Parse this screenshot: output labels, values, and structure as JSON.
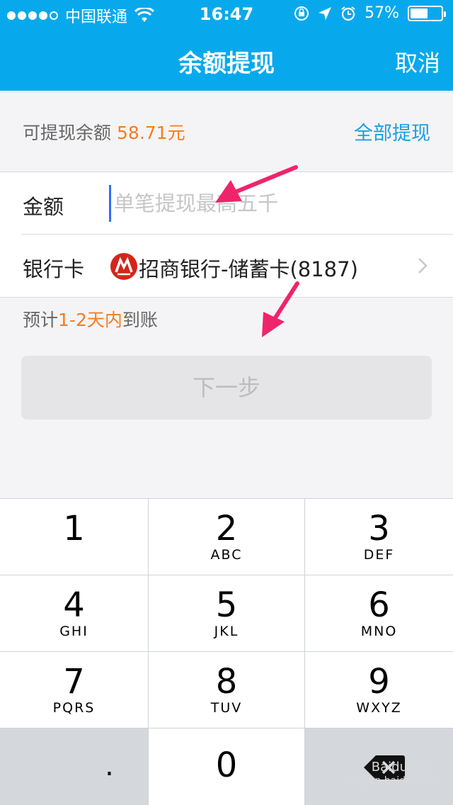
{
  "status_bar": {
    "carrier": "中国联通",
    "time": "16:47",
    "battery": "57%",
    "battery_level": 0.57
  },
  "nav": {
    "title": "余额提现",
    "cancel": "取消"
  },
  "balance": {
    "label": "可提现余额",
    "amount": "58.71元",
    "withdraw_all": "全部提现"
  },
  "form": {
    "amount_label": "金额",
    "amount_placeholder": "单笔提现最高五千",
    "card_label": "银行卡",
    "bank_name": "招商银行-储蓄卡(8187)"
  },
  "eta": {
    "prefix": "预计",
    "highlight": "1-2天内",
    "suffix": "到账"
  },
  "next_button": "下一步",
  "keypad": {
    "keys": [
      {
        "digit": "1",
        "letters": ""
      },
      {
        "digit": "2",
        "letters": "ABC"
      },
      {
        "digit": "3",
        "letters": "DEF"
      },
      {
        "digit": "4",
        "letters": "GHI"
      },
      {
        "digit": "5",
        "letters": "JKL"
      },
      {
        "digit": "6",
        "letters": "MNO"
      },
      {
        "digit": "7",
        "letters": "PQRS"
      },
      {
        "digit": "8",
        "letters": "TUV"
      },
      {
        "digit": "9",
        "letters": "WXYZ"
      }
    ],
    "dot": ".",
    "zero": "0"
  },
  "watermark": {
    "text": "Baidu经验",
    "url": "jingyan.baidu.com"
  },
  "colors": {
    "header": "#08a9ec",
    "accent_orange": "#f57d1e",
    "link_blue": "#1d9fdc",
    "arrow": "#f0246b"
  },
  "icons": [
    "wifi-icon",
    "rotation-lock-icon",
    "location-icon",
    "alarm-icon",
    "battery-icon",
    "bank-logo-icon",
    "chevron-right-icon",
    "delete-icon"
  ]
}
